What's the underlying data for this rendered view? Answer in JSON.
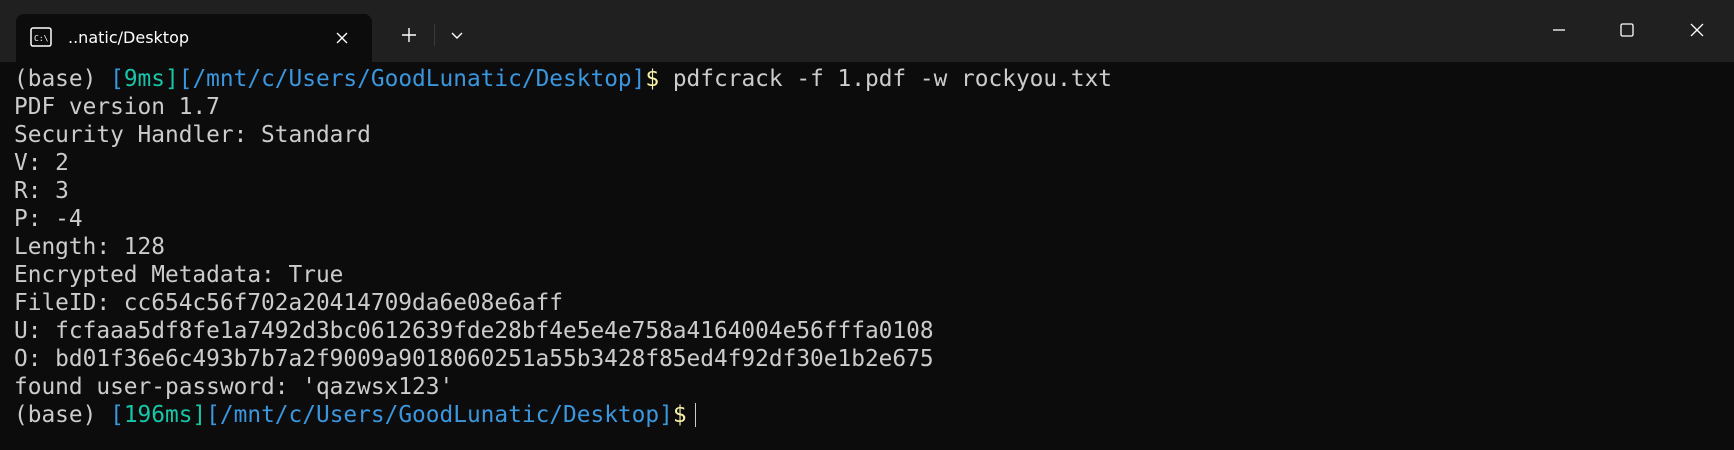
{
  "tab": {
    "title": "..natic/Desktop",
    "icon": "terminal-icon"
  },
  "window_controls": {
    "minimize_icon": "minimize-icon",
    "maximize_icon": "maximize-icon",
    "close_icon": "close-icon"
  },
  "prompt": {
    "env": "(base) ",
    "open_bracket": "[",
    "path": "[/mnt/c/Users/GoodLunatic/Desktop]",
    "symbol": "$"
  },
  "terminal": {
    "line1": {
      "time": "9ms]",
      "command": " pdfcrack -f 1.pdf -w rockyou.txt"
    },
    "output": [
      "PDF version 1.7",
      "Security Handler: Standard",
      "V: 2",
      "R: 3",
      "P: -4",
      "Length: 128",
      "Encrypted Metadata: True",
      "FileID: cc654c56f702a20414709da6e08e6aff",
      "U: fcfaaa5df8fe1a7492d3bc0612639fde28bf4e5e4e758a4164004e56fffa0108",
      "O: bd01f36e6c493b7b7a2f9009a9018060251a55b3428f85ed4f92df30e1b2e675",
      "found user-password: 'qazwsx123'"
    ],
    "line2": {
      "time": "196ms]"
    }
  },
  "colors": {
    "background": "#0c0c0c",
    "titlebar": "#202020",
    "text": "#cccccc",
    "prompt_bracket": "#3a96dd",
    "prompt_time": "#16c6a8",
    "prompt_path": "#3a96dd"
  }
}
